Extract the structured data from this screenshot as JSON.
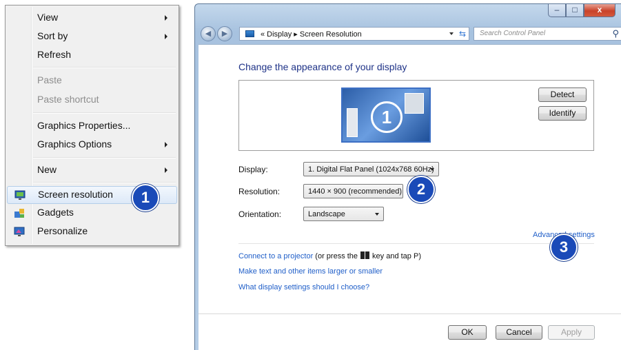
{
  "context_menu": {
    "items": [
      {
        "label": "View"
      },
      {
        "label": "Sort by"
      },
      {
        "label": "Refresh"
      },
      {
        "label": "Paste"
      },
      {
        "label": "Paste shortcut"
      },
      {
        "label": "Graphics Properties..."
      },
      {
        "label": "Graphics Options"
      },
      {
        "label": "New"
      },
      {
        "label": "Screen resolution"
      },
      {
        "label": "Gadgets"
      },
      {
        "label": "Personalize"
      }
    ]
  },
  "callouts": {
    "one": "1",
    "two": "2",
    "three": "3"
  },
  "window": {
    "caption": {
      "minimize": "–",
      "maximize": "□",
      "close": "x"
    },
    "nav": {
      "back": "◀",
      "forward": "▶"
    },
    "breadcrumb": "« Display ▸ Screen Resolution",
    "search_placeholder": "Search Control Panel",
    "heading": "Change the appearance of your display",
    "monitor_number": "1",
    "detect_label": "Detect",
    "identify_label": "Identify",
    "display_label": "Display:",
    "display_value": "1. Digital Flat Panel (1024x768 60Hz)",
    "resolution_label": "Resolution:",
    "resolution_value": "1440 × 900 (recommended)",
    "orientation_label": "Orientation:",
    "orientation_value": "Landscape",
    "advanced_link": "Advanced settings",
    "projector_link": "Connect to a projector",
    "projector_text_1": "(or press the",
    "projector_text_2": "key and tap P)",
    "text_size_link": "Make text and other items larger or smaller",
    "help_link": "What display settings should I choose?",
    "ok_label": "OK",
    "cancel_label": "Cancel",
    "apply_label": "Apply"
  },
  "colors": {
    "accent_link": "#1f5ec8",
    "heading": "#1e3287",
    "callout": "#1a4ab8"
  }
}
